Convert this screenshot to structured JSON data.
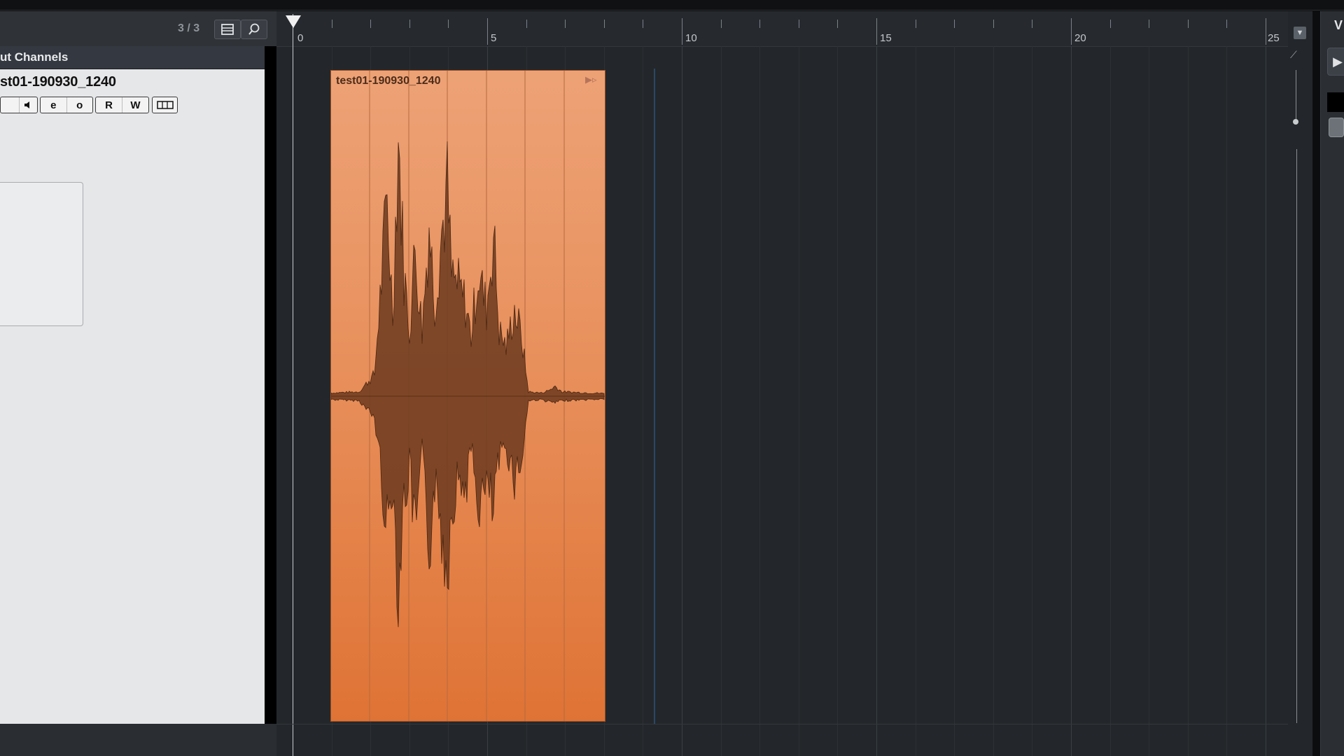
{
  "colors": {
    "event_fill_top": "#eda276",
    "event_fill_bottom": "#df7335",
    "waveform": "#6b3a1e",
    "grid_major": "#3a3f45",
    "grid_minor": "#2d3136"
  },
  "track_panel": {
    "count": "3 / 3",
    "folder_label": "ut Channels",
    "track_name": "st01-190930_1240",
    "buttons": {
      "edit_symbol": "e",
      "monitor_symbol": "o",
      "read": "R",
      "write": "W"
    }
  },
  "ruler": {
    "labels": [
      "0",
      "5",
      "10",
      "15",
      "20",
      "25"
    ]
  },
  "event": {
    "name": "test01-190930_1240"
  },
  "right_panel": {
    "label": "V"
  },
  "icons": [
    "list-view-icon",
    "search-icon",
    "speaker-icon",
    "play-icon",
    "pencil-icon",
    "zoom-dropdown-icon",
    "lanes-icon"
  ]
}
